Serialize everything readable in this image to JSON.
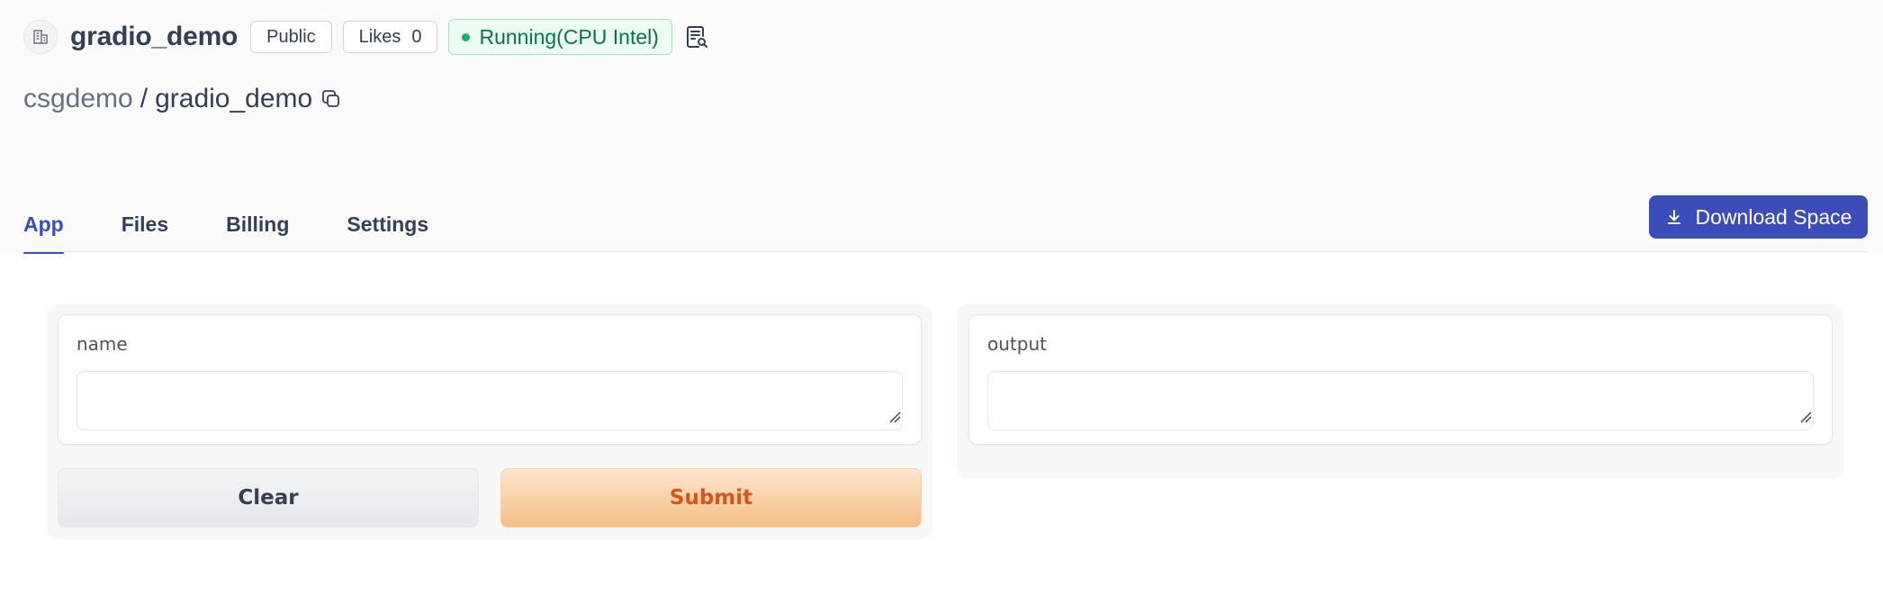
{
  "header": {
    "space_name": "gradio_demo",
    "visibility": "Public",
    "likes_label": "Likes",
    "likes_count": "0",
    "status": "Running(CPU Intel)",
    "status_color": "#17b26a"
  },
  "breadcrumb": {
    "owner": "csgdemo",
    "separator": "/",
    "repo": "gradio_demo"
  },
  "tabs": [
    {
      "label": "App",
      "active": true
    },
    {
      "label": "Files",
      "active": false
    },
    {
      "label": "Billing",
      "active": false
    },
    {
      "label": "Settings",
      "active": false
    }
  ],
  "actions": {
    "download_label": "Download Space",
    "accent_color": "#3b4db8"
  },
  "app": {
    "input_label": "name",
    "input_value": "",
    "output_label": "output",
    "output_value": "",
    "clear_label": "Clear",
    "submit_label": "Submit"
  },
  "icons": {
    "org": "building-icon",
    "report": "report-search-icon",
    "copy": "copy-icon",
    "download": "download-icon"
  }
}
